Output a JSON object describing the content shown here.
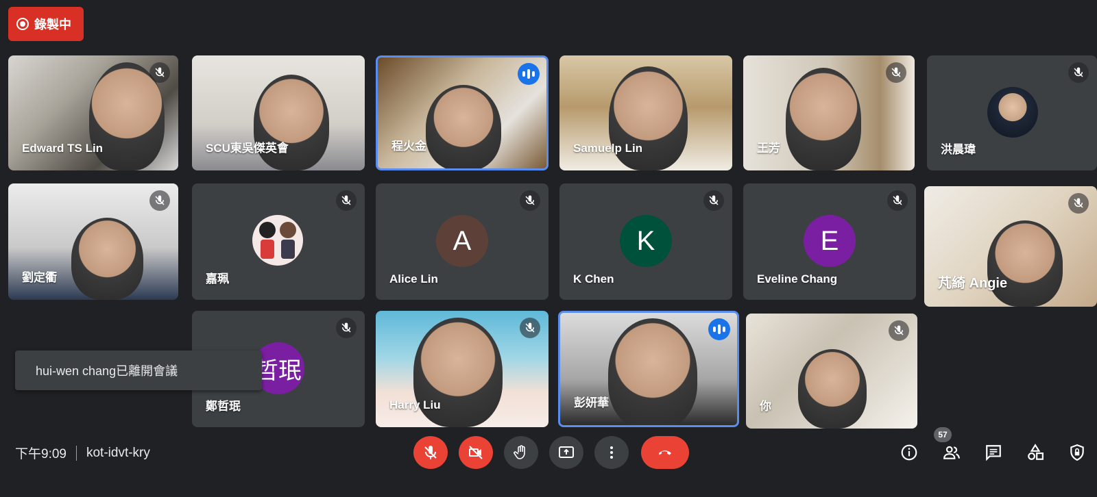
{
  "recording": {
    "label": "錄製中"
  },
  "participants": [
    {
      "name": "Edward TS Lin"
    },
    {
      "name": "SCU東吳傑英會"
    },
    {
      "name": "程火金"
    },
    {
      "name": "Samuelp Lin"
    },
    {
      "name": "王芳"
    },
    {
      "name": "洪晨瑋"
    },
    {
      "name": "劉定衢"
    },
    {
      "name": "嘉珮"
    },
    {
      "name": "Alice Lin",
      "initial": "A",
      "color": "#5d4037"
    },
    {
      "name": "K Chen",
      "initial": "K",
      "color": "#00513c"
    },
    {
      "name": "Eveline Chang",
      "initial": "E",
      "color": "#7b1fa2"
    },
    {
      "name": "芃綺 Angie"
    },
    {
      "name": "鄭哲珉",
      "initial": "哲珉",
      "color": "#7b1fa2"
    },
    {
      "name": "Harry Liu"
    },
    {
      "name": "彭妍華"
    },
    {
      "name": "你"
    }
  ],
  "toast": {
    "message": "hui-wen chang已離開會議"
  },
  "footer": {
    "time": "下午9:09",
    "meeting_code": "kot-idvt-kry",
    "participant_count": "57"
  },
  "colors": {
    "background": "#202124",
    "tile": "#3c4043",
    "red": "#ea4335",
    "speaking": "#1a73e8"
  },
  "icons": [
    "record-icon",
    "mic-off-icon",
    "audio-wave-icon",
    "camera-off-icon",
    "raise-hand-icon",
    "present-icon",
    "more-icon",
    "hang-up-icon",
    "info-icon",
    "people-icon",
    "chat-icon",
    "activities-icon",
    "host-controls-icon"
  ]
}
